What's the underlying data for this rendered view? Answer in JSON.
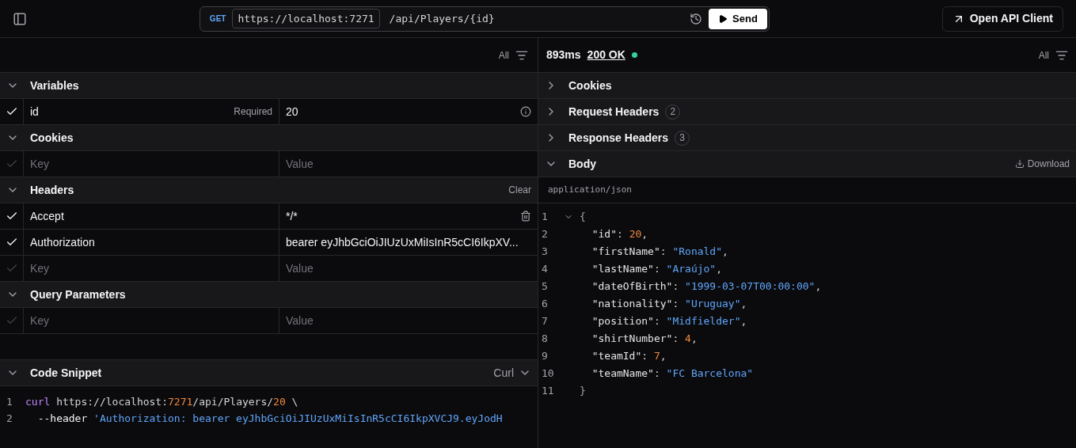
{
  "top_bar": {
    "method": "GET",
    "base_url": "https://localhost:7271",
    "path": "/api/Players/{id}",
    "send_label": "Send",
    "open_client_label": "Open API Client"
  },
  "request": {
    "filter_label": "All",
    "sections": [
      {
        "title": "Variables",
        "expanded": true,
        "rows": [
          {
            "checked": true,
            "key": "id",
            "hint": "Required",
            "value": "20",
            "kind": "info"
          }
        ]
      },
      {
        "title": "Cookies",
        "expanded": true,
        "rows": [
          {
            "checked": false,
            "key_placeholder": "Key",
            "value_placeholder": "Value",
            "kind": "plain"
          }
        ]
      },
      {
        "title": "Headers",
        "expanded": true,
        "clear_label": "Clear",
        "rows": [
          {
            "checked": true,
            "key": "Accept",
            "value": "*/*",
            "kind": "delete"
          },
          {
            "checked": true,
            "key": "Authorization",
            "value": "bearer eyJhbGciOiJIUzUxMiIsInR5cCI6IkpXV...",
            "kind": "plain"
          },
          {
            "checked": false,
            "key_placeholder": "Key",
            "value_placeholder": "Value",
            "kind": "plain"
          }
        ]
      },
      {
        "title": "Query Parameters",
        "expanded": true,
        "rows": [
          {
            "checked": false,
            "key_placeholder": "Key",
            "value_placeholder": "Value",
            "kind": "plain"
          }
        ]
      }
    ],
    "code_snippet": {
      "title": "Code Snippet",
      "expanded": true,
      "language": "Curl",
      "lines": [
        {
          "number": "1",
          "tokens": [
            {
              "kind": "command",
              "text": "curl"
            },
            {
              "kind": "plain",
              "text": " https://localhost:"
            },
            {
              "kind": "number",
              "text": "7271"
            },
            {
              "kind": "plain",
              "text": "/api/Players/"
            },
            {
              "kind": "number",
              "text": "20"
            },
            {
              "kind": "plain",
              "text": " \\"
            }
          ]
        },
        {
          "number": "2",
          "tokens": [
            {
              "kind": "flag",
              "text": "  --header "
            },
            {
              "kind": "string",
              "text": "'Authorization: bearer eyJhbGciOiJIUzUxMiIsInR5cCI6IkpXVCJ9.eyJodH"
            }
          ]
        }
      ]
    }
  },
  "response": {
    "time": "893ms",
    "status": "200 OK",
    "status_dot": {
      "color": "#34d399"
    },
    "filter_label": "All",
    "sections": [
      {
        "title": "Cookies",
        "expanded": false
      },
      {
        "title": "Request Headers",
        "expanded": false,
        "count": "2"
      },
      {
        "title": "Response Headers",
        "expanded": false,
        "count": "3"
      },
      {
        "title": "Body",
        "expanded": true,
        "download_label": "Download"
      }
    ],
    "content_type": "application/json",
    "body_lines": [
      {
        "number": "1",
        "foldable": true,
        "tokens": [
          {
            "kind": "punct",
            "text": "{"
          }
        ]
      },
      {
        "number": "2",
        "foldable": false,
        "tokens": [
          {
            "kind": "key",
            "text": "  \"id\""
          },
          {
            "kind": "plain",
            "text": ": "
          },
          {
            "kind": "number",
            "text": "20"
          },
          {
            "kind": "plain",
            "text": ","
          }
        ]
      },
      {
        "number": "3",
        "foldable": false,
        "tokens": [
          {
            "kind": "key",
            "text": "  \"firstName\""
          },
          {
            "kind": "plain",
            "text": ": "
          },
          {
            "kind": "string",
            "text": "\"Ronald\""
          },
          {
            "kind": "plain",
            "text": ","
          }
        ]
      },
      {
        "number": "4",
        "foldable": false,
        "tokens": [
          {
            "kind": "key",
            "text": "  \"lastName\""
          },
          {
            "kind": "plain",
            "text": ": "
          },
          {
            "kind": "string",
            "text": "\"Araújo\""
          },
          {
            "kind": "plain",
            "text": ","
          }
        ]
      },
      {
        "number": "5",
        "foldable": false,
        "tokens": [
          {
            "kind": "key",
            "text": "  \"dateOfBirth\""
          },
          {
            "kind": "plain",
            "text": ": "
          },
          {
            "kind": "string",
            "text": "\"1999-03-07T00:00:00\""
          },
          {
            "kind": "plain",
            "text": ","
          }
        ]
      },
      {
        "number": "6",
        "foldable": false,
        "tokens": [
          {
            "kind": "key",
            "text": "  \"nationality\""
          },
          {
            "kind": "plain",
            "text": ": "
          },
          {
            "kind": "string",
            "text": "\"Uruguay\""
          },
          {
            "kind": "plain",
            "text": ","
          }
        ]
      },
      {
        "number": "7",
        "foldable": false,
        "tokens": [
          {
            "kind": "key",
            "text": "  \"position\""
          },
          {
            "kind": "plain",
            "text": ": "
          },
          {
            "kind": "string",
            "text": "\"Midfielder\""
          },
          {
            "kind": "plain",
            "text": ","
          }
        ]
      },
      {
        "number": "8",
        "foldable": false,
        "tokens": [
          {
            "kind": "key",
            "text": "  \"shirtNumber\""
          },
          {
            "kind": "plain",
            "text": ": "
          },
          {
            "kind": "number",
            "text": "4"
          },
          {
            "kind": "plain",
            "text": ","
          }
        ]
      },
      {
        "number": "9",
        "foldable": false,
        "tokens": [
          {
            "kind": "key",
            "text": "  \"teamId\""
          },
          {
            "kind": "plain",
            "text": ": "
          },
          {
            "kind": "number",
            "text": "7"
          },
          {
            "kind": "plain",
            "text": ","
          }
        ]
      },
      {
        "number": "10",
        "foldable": false,
        "tokens": [
          {
            "kind": "key",
            "text": "  \"teamName\""
          },
          {
            "kind": "plain",
            "text": ": "
          },
          {
            "kind": "string",
            "text": "\"FC Barcelona\""
          }
        ]
      },
      {
        "number": "11",
        "foldable": false,
        "tokens": [
          {
            "kind": "punct",
            "text": "}"
          }
        ]
      }
    ]
  }
}
